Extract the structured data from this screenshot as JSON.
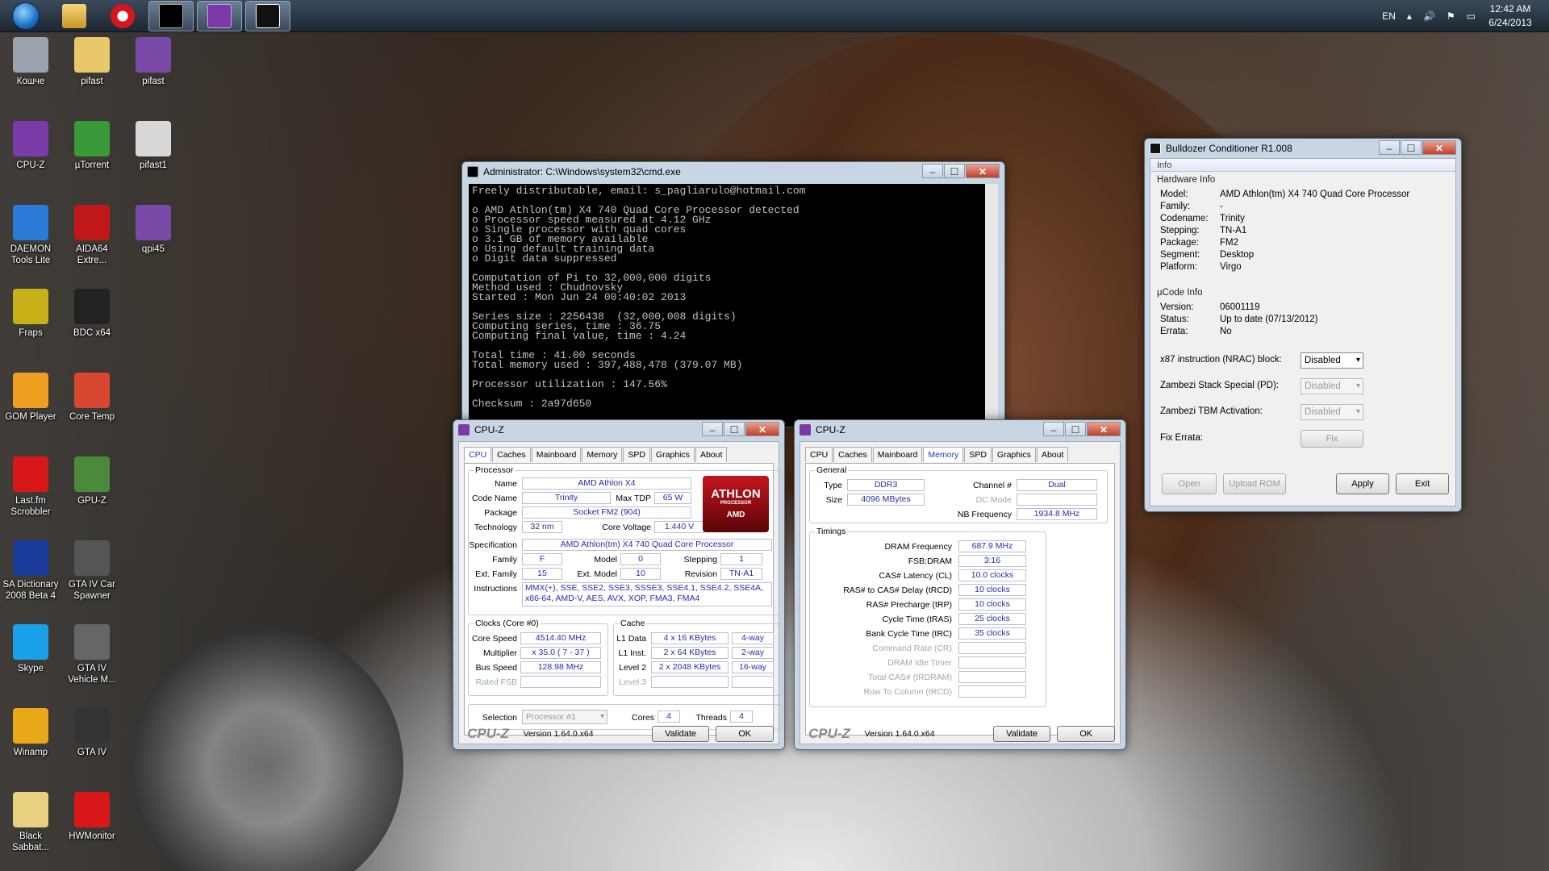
{
  "taskbar": {
    "lang": "EN",
    "time": "12:42 AM",
    "date": "6/24/2013"
  },
  "desktop_icons": [
    {
      "label": "Кошче",
      "color": "#9aa3ad"
    },
    {
      "label": "pifast",
      "color": "#e8c86a"
    },
    {
      "label": "pifast",
      "color": "#7a4aa8"
    },
    {
      "label": "CPU-Z",
      "color": "#7a3aa8"
    },
    {
      "label": "µTorrent",
      "color": "#3a9a3a"
    },
    {
      "label": "pifast1",
      "color": "#d8d8d8"
    },
    {
      "label": "DAEMON Tools Lite",
      "color": "#2a7ad8"
    },
    {
      "label": "AIDA64 Extre...",
      "color": "#c01818"
    },
    {
      "label": "qpi45",
      "color": "#7a4aa8"
    },
    {
      "label": "Fraps",
      "color": "#c8b018"
    },
    {
      "label": "BDC x64",
      "color": "#222222"
    },
    {
      "label": "GOM Player",
      "color": "#f0a020"
    },
    {
      "label": "Core Temp",
      "color": "#d84830"
    },
    {
      "label": "Last.fm Scrobbler",
      "color": "#d81818"
    },
    {
      "label": "GPU-Z",
      "color": "#4a8a3a"
    },
    {
      "label": "SA Dictionary 2008 Beta 4",
      "color": "#1a3a9a"
    },
    {
      "label": "GTA IV Car Spawner",
      "color": "#555555"
    },
    {
      "label": "Skype",
      "color": "#18a0e8"
    },
    {
      "label": "GTA IV Vehicle M...",
      "color": "#666666"
    },
    {
      "label": "Winamp",
      "color": "#e8a818"
    },
    {
      "label": "GTA IV",
      "color": "#333333"
    },
    {
      "label": "Black Sabbat...",
      "color": "#e8d080"
    },
    {
      "label": "HWMonitor",
      "color": "#d81818"
    }
  ],
  "cmd": {
    "title": "Administrator: C:\\Windows\\system32\\cmd.exe",
    "lines": [
      "Freely distributable, email: s_pagliarulo@hotmail.com",
      "",
      "o AMD Athlon(tm) X4 740 Quad Core Processor detected",
      "o Processor speed measured at 4.12 GHz",
      "o Single processor with quad cores",
      "o 3.1 GB of memory available",
      "o Using default training data",
      "o Digit data suppressed",
      "",
      "Computation of Pi to 32,000,000 digits",
      "Method used : Chudnovsky",
      "Started : Mon Jun 24 00:40:02 2013",
      "",
      "Series size : 2256438  (32,000,008 digits)",
      "Computing series, time : 36.75",
      "Computing final value, time : 4.24",
      "",
      "Total time : 41.00 seconds",
      "Total memory used : 397,488,478 (379.07 MB)",
      "",
      "Processor utilization : 147.56%",
      "",
      "Checksum : 2a97d650"
    ]
  },
  "cpuz_cpu": {
    "title": "CPU-Z",
    "tabs": [
      "CPU",
      "Caches",
      "Mainboard",
      "Memory",
      "SPD",
      "Graphics",
      "About"
    ],
    "processor": {
      "legend": "Processor",
      "name_l": "Name",
      "name": "AMD Athlon X4",
      "code_l": "Code Name",
      "code": "Trinity",
      "tdp_l": "Max TDP",
      "tdp": "65 W",
      "pkg_l": "Package",
      "pkg": "Socket FM2 (904)",
      "tech_l": "Technology",
      "tech": "32 nm",
      "cv_l": "Core Voltage",
      "cv": "1.440 V",
      "spec_l": "Specification",
      "spec": "AMD Athlon(tm) X4 740 Quad Core Processor",
      "fam_l": "Family",
      "fam": "F",
      "model_l": "Model",
      "model": "0",
      "step_l": "Stepping",
      "step": "1",
      "efam_l": "Ext. Family",
      "efam": "15",
      "emodel_l": "Ext. Model",
      "emodel": "10",
      "rev_l": "Revision",
      "rev": "TN-A1",
      "inst_l": "Instructions",
      "inst1": "MMX(+), SSE, SSE2, SSE3, SSSE3, SSE4.1, SSE4.2, SSE4A,",
      "inst2": "x86-64, AMD-V, AES, AVX, XOP, FMA3, FMA4",
      "logo1": "ATHLON",
      "logo2": "PROCESSOR",
      "logo3": "AMD"
    },
    "clocks": {
      "legend": "Clocks (Core #0)",
      "cs_l": "Core Speed",
      "cs": "4514.40 MHz",
      "mul_l": "Multiplier",
      "mul": "x 35.0 ( 7 - 37 )",
      "bus_l": "Bus Speed",
      "bus": "128.98 MHz",
      "fsb_l": "Rated FSB"
    },
    "cache": {
      "legend": "Cache",
      "l1d_l": "L1 Data",
      "l1d": "4 x 16 KBytes",
      "l1d_w": "4-way",
      "l1i_l": "L1 Inst.",
      "l1i": "2 x 64 KBytes",
      "l1i_w": "2-way",
      "l2_l": "Level 2",
      "l2": "2 x 2048 KBytes",
      "l2_w": "16-way",
      "l3_l": "Level 3"
    },
    "sel_l": "Selection",
    "sel": "Processor #1",
    "cores_l": "Cores",
    "cores": "4",
    "threads_l": "Threads",
    "threads": "4",
    "logo": "CPU-Z",
    "version": "Version 1.64.0.x64",
    "validate": "Validate",
    "ok": "OK"
  },
  "cpuz_mem": {
    "title": "CPU-Z",
    "tabs": [
      "CPU",
      "Caches",
      "Mainboard",
      "Memory",
      "SPD",
      "Graphics",
      "About"
    ],
    "general": {
      "legend": "General",
      "type_l": "Type",
      "type": "DDR3",
      "ch_l": "Channel #",
      "ch": "Dual",
      "size_l": "Size",
      "size": "4096 MBytes",
      "dc_l": "DC Mode",
      "nb_l": "NB Frequency",
      "nb": "1934.8 MHz"
    },
    "timings": {
      "legend": "Timings",
      "rows": [
        {
          "l": "DRAM Frequency",
          "v": "687.9 MHz"
        },
        {
          "l": "FSB:DRAM",
          "v": "3:16"
        },
        {
          "l": "CAS# Latency (CL)",
          "v": "10.0 clocks"
        },
        {
          "l": "RAS# to CAS# Delay (tRCD)",
          "v": "10 clocks"
        },
        {
          "l": "RAS# Precharge (tRP)",
          "v": "10 clocks"
        },
        {
          "l": "Cycle Time (tRAS)",
          "v": "25 clocks"
        },
        {
          "l": "Bank Cycle Time (tRC)",
          "v": "35 clocks"
        },
        {
          "l": "Command Rate (CR)",
          "v": ""
        },
        {
          "l": "DRAM Idle Timer",
          "v": ""
        },
        {
          "l": "Total CAS# (tRDRAM)",
          "v": ""
        },
        {
          "l": "Row To Column (tRCD)",
          "v": ""
        }
      ]
    },
    "logo": "CPU-Z",
    "version": "Version 1.64.0.x64",
    "validate": "Validate",
    "ok": "OK"
  },
  "bdc": {
    "title": "Bulldozer Conditioner R1.008",
    "tab": "Info",
    "hw_legend": "Hardware Info",
    "hw": [
      {
        "l": "Model:",
        "v": "AMD Athlon(tm) X4 740 Quad Core Processor"
      },
      {
        "l": "Family:",
        "v": "-"
      },
      {
        "l": "Codename:",
        "v": "Trinity"
      },
      {
        "l": "Stepping:",
        "v": "TN-A1"
      },
      {
        "l": "Package:",
        "v": "FM2"
      },
      {
        "l": "Segment:",
        "v": "Desktop"
      },
      {
        "l": "Platform:",
        "v": "Virgo"
      }
    ],
    "uc_legend": "µCode Info",
    "uc": [
      {
        "l": "Version:",
        "v": "06001119"
      },
      {
        "l": "Status:",
        "v": "Up to date (07/13/2012)"
      },
      {
        "l": "Errata:",
        "v": "No"
      }
    ],
    "opts": [
      {
        "l": "x87 instruction (NRAC) block:",
        "v": "Disabled"
      },
      {
        "l": "Zambezi Stack Special (PD):",
        "v": "Disabled"
      },
      {
        "l": "Zambezi TBM Activation:",
        "v": "Disabled"
      }
    ],
    "fix_l": "Fix Errata:",
    "fix": "Fix",
    "open": "Open",
    "upload": "Upload ROM",
    "apply": "Apply",
    "exit": "Exit"
  }
}
